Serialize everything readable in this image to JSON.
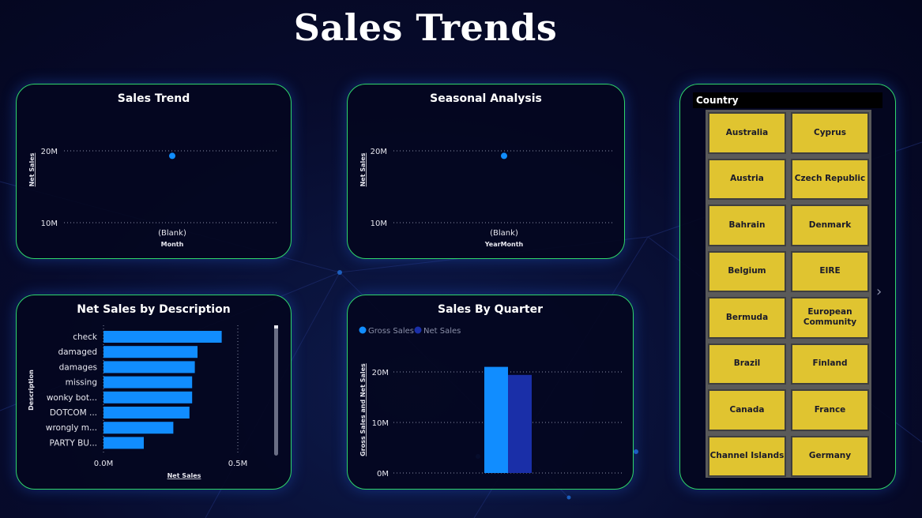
{
  "page": {
    "title": "Sales Trends"
  },
  "sales_trend": {
    "title": "Sales Trend",
    "ylabel": "Net Sales",
    "xlabel": "Month",
    "yticks": [
      "20M",
      "10M"
    ],
    "xtick": "(Blank)"
  },
  "seasonal": {
    "title": "Seasonal Analysis",
    "ylabel": "Net Sales",
    "xlabel": "YearMonth",
    "yticks": [
      "20M",
      "10M"
    ],
    "xtick": "(Blank)"
  },
  "net_sales_desc": {
    "title": "Net Sales by Description",
    "ylabel": "Description",
    "xlabel": "Net Sales",
    "xticks": [
      "0.0M",
      "0.5M"
    ]
  },
  "quarter": {
    "title": "Sales By Quarter",
    "ylabel": "Gross Sales and Net Sales",
    "yticks": [
      "20M",
      "10M",
      "0M"
    ],
    "legend": [
      "Gross Sales",
      "Net Sales"
    ]
  },
  "country": {
    "header": "Country",
    "next_icon": "chevron-right-icon",
    "items": [
      "Australia",
      "Cyprus",
      "Austria",
      "Czech Republic",
      "Bahrain",
      "Denmark",
      "Belgium",
      "EIRE",
      "Bermuda",
      "European Community",
      "Brazil",
      "Finland",
      "Canada",
      "France",
      "Channel Islands",
      "Germany"
    ]
  },
  "colors": {
    "accent": "#118dff",
    "dark_series": "#1a2fa8",
    "border": "#2fd66a",
    "slicer": "#e0c430"
  },
  "chart_data": [
    {
      "type": "scatter",
      "title": "Sales Trend",
      "xlabel": "Month",
      "ylabel": "Net Sales",
      "x": [
        "(Blank)"
      ],
      "y": [
        19300000
      ],
      "ylim": [
        10000000,
        20000000
      ]
    },
    {
      "type": "scatter",
      "title": "Seasonal Analysis",
      "xlabel": "YearMonth",
      "ylabel": "Net Sales",
      "x": [
        "(Blank)"
      ],
      "y": [
        19300000
      ],
      "ylim": [
        10000000,
        20000000
      ]
    },
    {
      "type": "bar",
      "orientation": "horizontal",
      "title": "Net Sales by Description",
      "xlabel": "Net Sales",
      "ylabel": "Description",
      "categories": [
        "check",
        "damaged",
        "damages",
        "missing",
        "wonky bot...",
        "DOTCOM ...",
        "wrongly m...",
        "PARTY BU..."
      ],
      "values": [
        0.44,
        0.35,
        0.34,
        0.33,
        0.33,
        0.32,
        0.26,
        0.15
      ],
      "xlim": [
        0,
        0.5
      ],
      "grid": true
    },
    {
      "type": "bar",
      "title": "Sales By Quarter",
      "ylabel": "Gross Sales and Net Sales",
      "categories": [
        ""
      ],
      "series": [
        {
          "name": "Gross Sales",
          "values": [
            21000000
          ]
        },
        {
          "name": "Net Sales",
          "values": [
            19400000
          ]
        }
      ],
      "ylim": [
        0,
        20000000
      ],
      "legend": "top-left"
    }
  ]
}
